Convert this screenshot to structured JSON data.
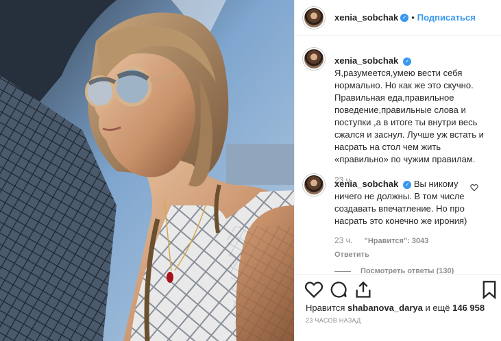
{
  "header": {
    "username": "xenia_sobchak",
    "follow_label": "Подписаться",
    "separator": "•"
  },
  "caption": {
    "username": "xenia_sobchak",
    "text": "Я,разумеется,умею вести себя нормально. Но как же это скучно. Правильная еда,правильное поведение,правильные слова и поступки ,а в итоге ты внутри весь сжался и заснул. Лучше уж встать и насрать на стол чем жить «правильно» по чужим правилам.",
    "time": "23 ч."
  },
  "reply": {
    "username": "xenia_sobchak",
    "text": "Вы никому ничего не должны. В том числе создавать впечатление. Но про насрать это конечно же ирония)",
    "time": "23 ч.",
    "likes": "\"Нравится\": 3043",
    "reply_label": "Ответить",
    "view_replies": "Посмотреть ответы (130)"
  },
  "footer": {
    "likes_prefix": "Нравится",
    "likes_user": "shabanova_darya",
    "likes_mid": "и ещё",
    "likes_count": "146 958",
    "timestamp": "23 ЧАСОВ НАЗАД"
  },
  "icons": {
    "like": "heart-icon",
    "comment": "comment-icon",
    "share": "share-icon",
    "save": "bookmark-icon",
    "verified": "verified-icon"
  },
  "colors": {
    "link": "#3897f0",
    "text": "#262626",
    "muted": "#8e8e8e",
    "border": "#efefef"
  }
}
